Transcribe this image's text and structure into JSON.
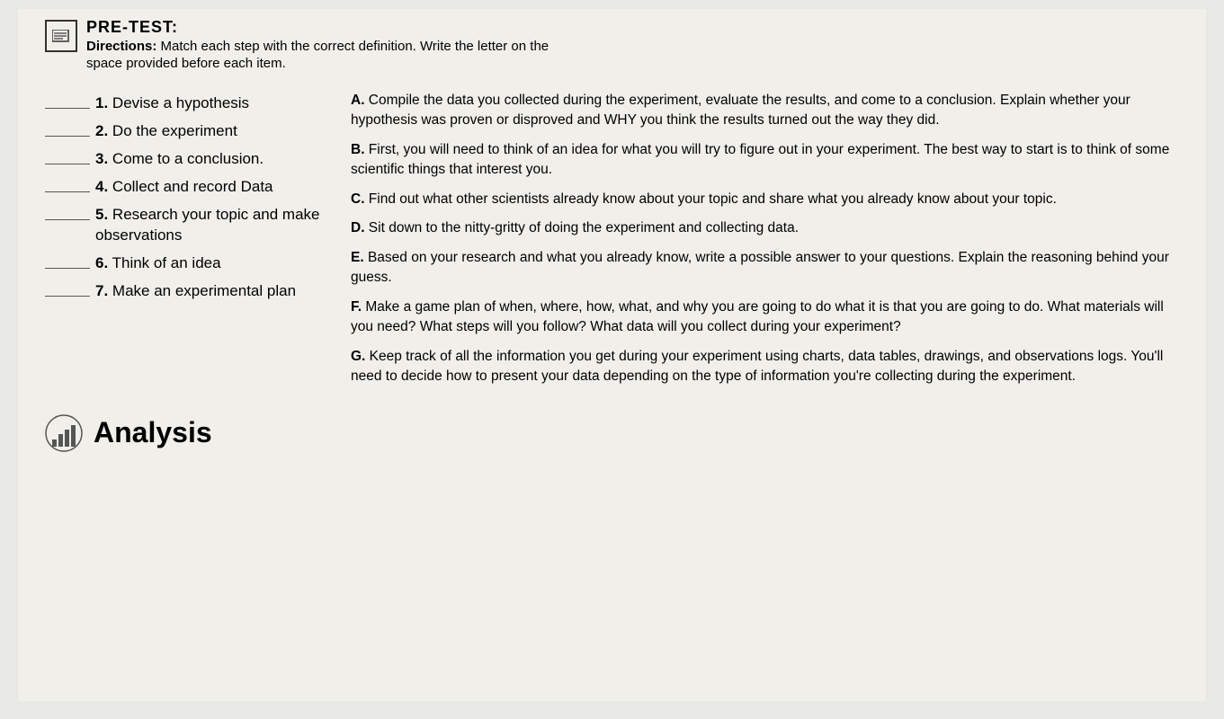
{
  "header": {
    "pre_test_label": "PRE-TEST:",
    "directions_bold": "Directions:",
    "directions_text": " Match each step with the correct definition. Write the letter on the",
    "space_provided": "space provided before each item."
  },
  "left_items": [
    {
      "number": "1.",
      "text": "Devise a hypothesis"
    },
    {
      "number": "2.",
      "text": "Do the experiment"
    },
    {
      "number": "3.",
      "text": "Come to a conclusion."
    },
    {
      "number": "4.",
      "text": "Collect and record Data"
    },
    {
      "number": "5.",
      "text": "Research your topic and make observations"
    },
    {
      "number": "6.",
      "text": "Think of an idea"
    },
    {
      "number": "7.",
      "text": "Make an experimental plan"
    }
  ],
  "definitions": [
    {
      "label": "A.",
      "text": " Compile the data you collected during the experiment, evaluate the results, and come to a conclusion. Explain whether your hypothesis was proven or disproved and WHY you think the results turned out the way they did."
    },
    {
      "label": "B.",
      "text": " First, you will need to think of an idea for what you will try to figure out in your experiment. The best way to start is to think of some scientific things that interest you."
    },
    {
      "label": "C.",
      "text": " Find out what other scientists already know about your topic and share what you already know about your topic."
    },
    {
      "label": "D.",
      "text": " Sit down to the nitty-gritty of doing the experiment and collecting data."
    },
    {
      "label": "E.",
      "text": " Based on your research and what you already know, write a possible answer to your questions. Explain the reasoning behind your guess."
    },
    {
      "label": "F.",
      "text": " Make a game plan of when, where, how, what, and why you are going to do what it is that you are going to do. What materials will you need? What steps will you follow? What data will you collect during your experiment?"
    },
    {
      "label": "G.",
      "text": " Keep track of all the information you get during your experiment using charts, data tables, drawings, and observations logs. You'll need to decide how to present your data depending on the type of information you're collecting during the experiment."
    }
  ],
  "bottom": {
    "analysis_label": "Analysis"
  }
}
